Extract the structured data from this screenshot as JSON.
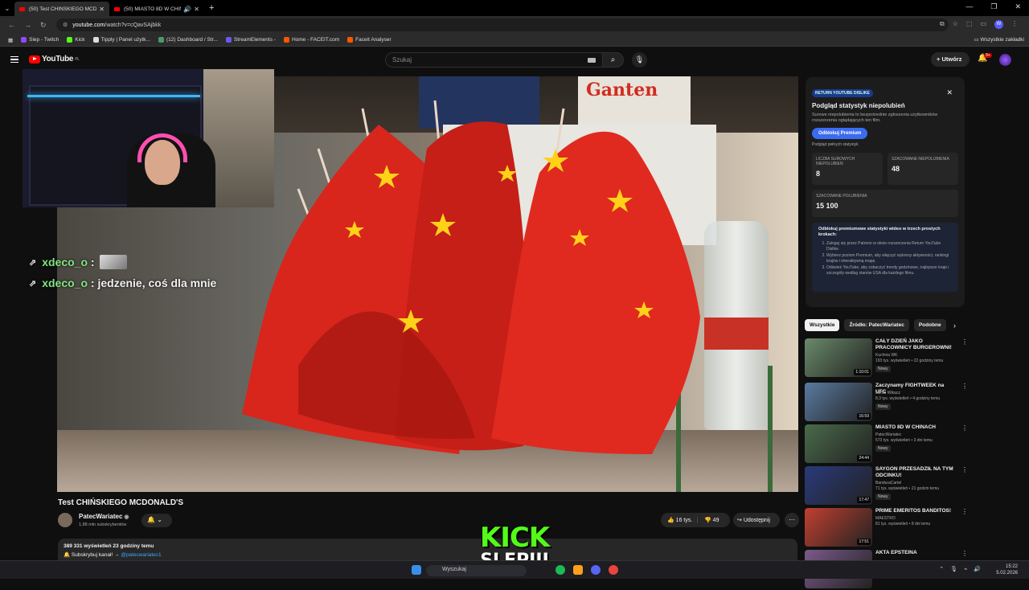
{
  "browser": {
    "tabs": [
      {
        "title": "(50) Test CHIŃSKIEGO MCDONALD'S",
        "active": true
      },
      {
        "title": "(50) MIASTO 8D W CHINACH",
        "active": false
      }
    ],
    "url_domain": "youtube.com",
    "url_path": "/watch?v=cQavSAjbkk",
    "bookmarks": [
      "Slep - Twitch",
      "Kick",
      "Tipply | Panel użytk...",
      "(12) Dashboard / Str...",
      "StreamElements -",
      "Home - FACEIT.com",
      "Faceit Analyser"
    ],
    "all_bookmarks": "Wszystkie zakładki",
    "profile_initial": "W"
  },
  "youtube": {
    "logo_text": "YouTube",
    "logo_region": "PL",
    "search_placeholder": "Szukaj",
    "create_label": "Utwórz",
    "notif_badge": "9+"
  },
  "overlay": {
    "chat": [
      {
        "user": "xdeco_o",
        "text": ":"
      },
      {
        "user": "xdeco_o",
        "text": ": jedzenie, coś dla mnie"
      }
    ],
    "kick_line1": "KICK",
    "kick_line2": "SLEPIII"
  },
  "video": {
    "title": "Test CHIŃSKIEGO MCDONALD'S",
    "channel": "PatecWariatec",
    "subscribers": "1,88 mln subskrybentów",
    "likes": "16 tys.",
    "dislikes": "49",
    "share_label": "Udostępnij",
    "views_line": "389 331 wyświetleń  23 godziny temu",
    "desc_line": "Subskrybuj kanał!",
    "desc_link": "@patecwariatec1",
    "scene_brand": "Ganten"
  },
  "ryd_panel": {
    "tag": "RETURN YOUTUBE DISLIKE",
    "heading": "Podgląd statystyk niepolubień",
    "text": "Surowe niepolubienia to bezpośrednie zgłoszenia użytkowników rozszerzenia oglądających ten film.",
    "button": "Odblokuj Premium",
    "link": "Podgląd pełnych statystyk",
    "raw_label": "LICZBA SUROWYCH NIEPOLUBIEŃ",
    "raw_value": "8",
    "est_dislikes_label": "SZACOWANE NIEPOLUBIENIA",
    "est_dislikes_value": "48",
    "est_likes_label": "SZACOWANE POLUBIENIA",
    "est_likes_value": "15 100",
    "promo_title": "Odblokuj premiumowe statystyki wideo w trzech prostych krokach:",
    "promo_steps": [
      "Zaloguj się przez Patreon w oknie rozszerzenia Return YouTube Dislike.",
      "Wybierz poziom Premium, aby włączyć wykresy aktywności, rankingi krajów i interaktywną mapę.",
      "Odśwież YouTube, aby zobaczyć trendy godzinowe, najlepsze kraje i szczegóły według stanów USA dla każdego filmu."
    ]
  },
  "chips": [
    "Wszystkie",
    "Źródło: PatecWariatec",
    "Podobne"
  ],
  "recommendations": [
    {
      "title": "CAŁY DZIEŃ JAKO PRACOWNICY BURGEROWNI!",
      "channel": "Kuchnia WK",
      "meta": "193 tys. wyświetleń • 22 godziny temu",
      "badge": "Nowy",
      "duration": "1:10:01",
      "color": "#6a8a6a"
    },
    {
      "title": "Zaczynamy FIGHTWEEK na UFC",
      "channel": "Jakub Wikacz",
      "meta": "8,3 tys. wyświetleń • 4 godziny temu",
      "badge": "Nowy",
      "duration": "16:59",
      "color": "#5a7aa0"
    },
    {
      "title": "MIASTO 8D W CHINACH",
      "channel": "PatecWariatec",
      "meta": "573 tys. wyświetleń • 3 dni temu",
      "badge": "Nowy",
      "duration": "24:44",
      "color": "#4a6a4a"
    },
    {
      "title": "SAYGON PRZESADZIŁ NA TYM ODCINKU!",
      "channel": "BanduraCartel",
      "meta": "71 tys. wyświetleń • 21 godzin temu",
      "badge": "Nowy",
      "duration": "17:47",
      "color": "#2a3a7a"
    },
    {
      "title": "PRIME EMERITOS BANDITOS!",
      "channel": "MAESTRO",
      "meta": "81 tys. wyświetleń • 8 dni temu",
      "badge": "",
      "duration": "17:51",
      "color": "#c04030"
    },
    {
      "title": "AKTA EPSTEINA",
      "channel": "",
      "meta": "",
      "badge": "",
      "duration": "",
      "color": "#7a5a8a"
    }
  ],
  "taskbar": {
    "search": "Wyszukaj",
    "time": "15:22",
    "date": "5.02.2026"
  }
}
